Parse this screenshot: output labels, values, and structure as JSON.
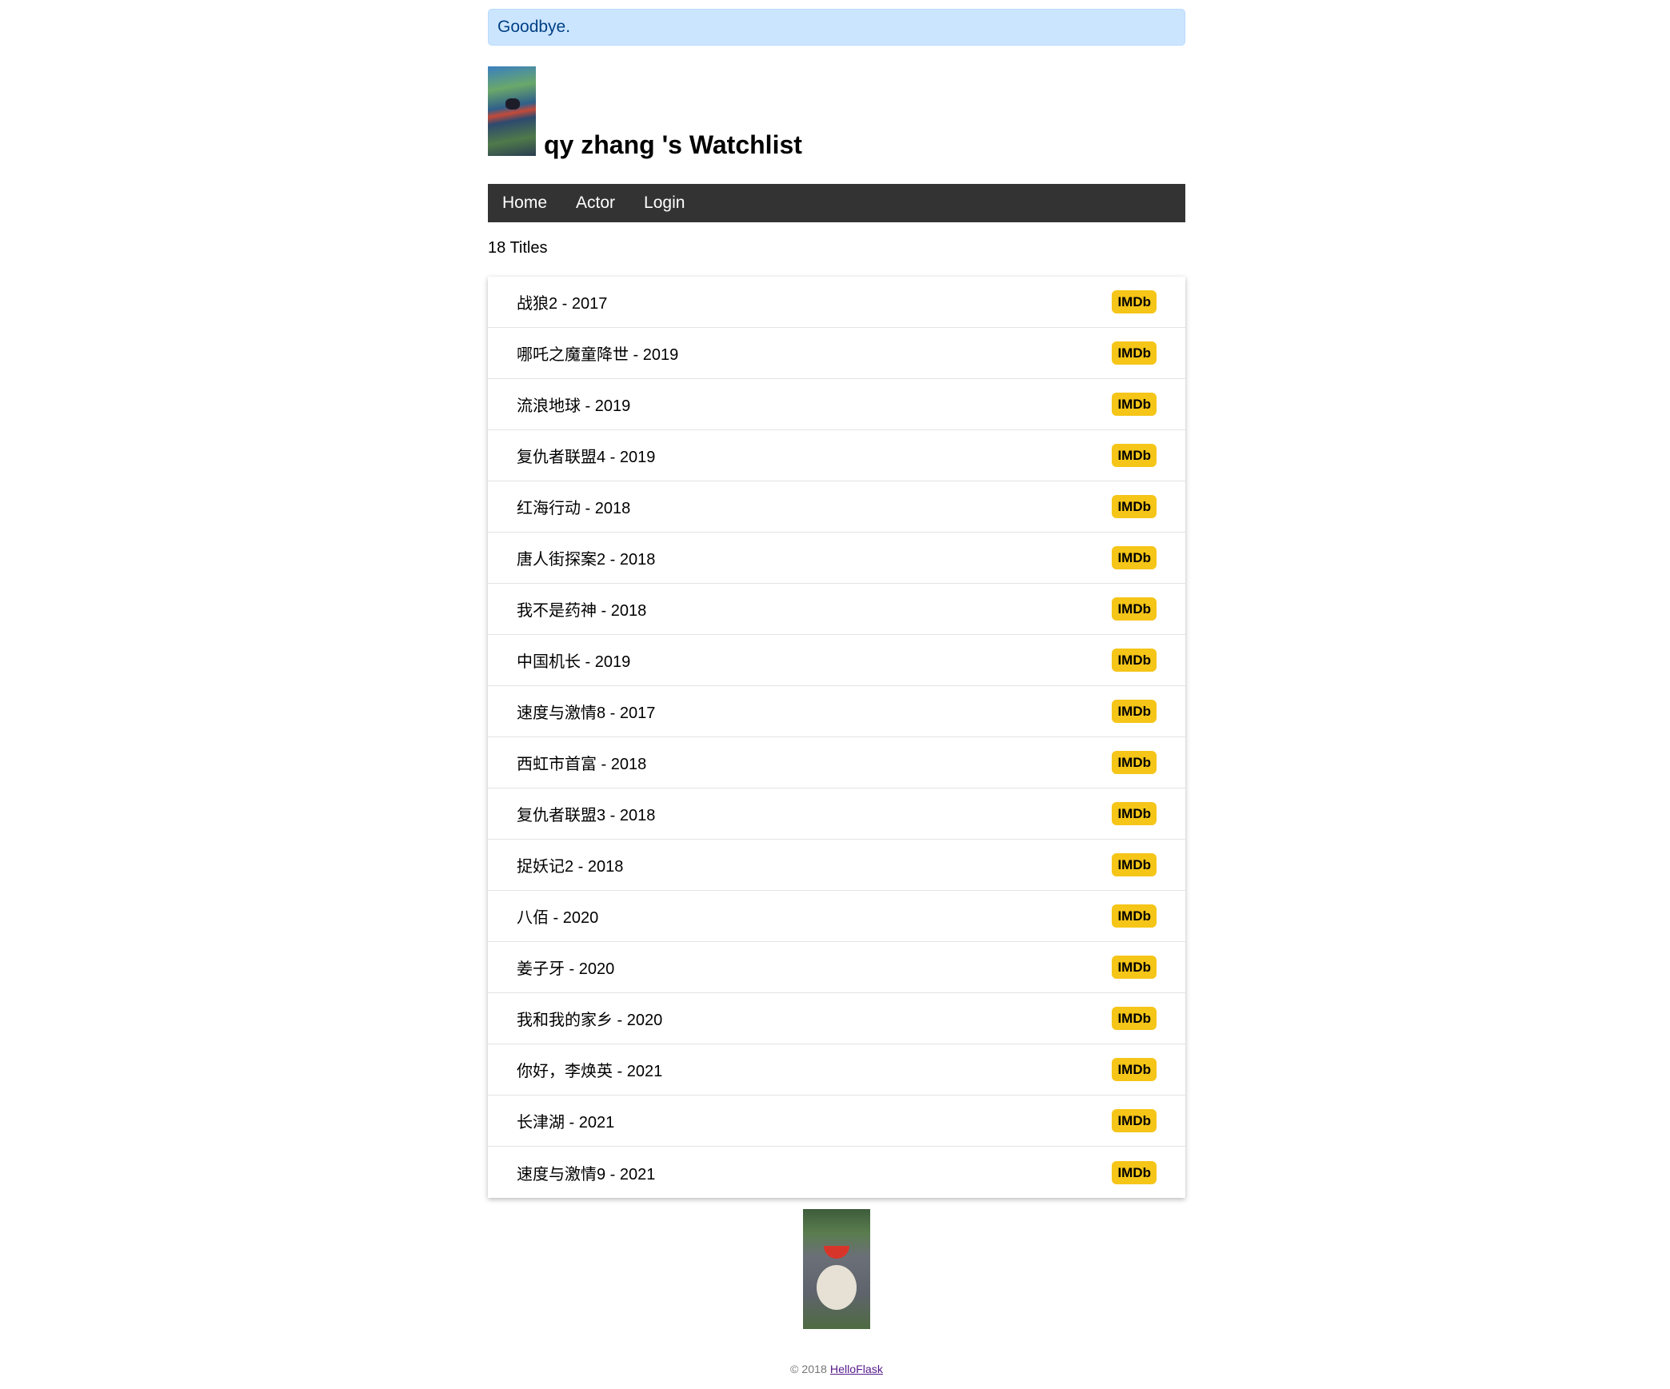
{
  "flash": {
    "message": "Goodbye."
  },
  "header": {
    "title": "qy zhang 's Watchlist"
  },
  "nav": {
    "items": [
      {
        "label": "Home"
      },
      {
        "label": "Actor"
      },
      {
        "label": "Login"
      }
    ]
  },
  "summary": {
    "count_text": "18 Titles"
  },
  "movies": [
    {
      "label": "战狼2 - 2017",
      "link": "IMDb"
    },
    {
      "label": "哪吒之魔童降世 - 2019",
      "link": "IMDb"
    },
    {
      "label": "流浪地球 - 2019",
      "link": "IMDb"
    },
    {
      "label": "复仇者联盟4 - 2019",
      "link": "IMDb"
    },
    {
      "label": "红海行动 - 2018",
      "link": "IMDb"
    },
    {
      "label": "唐人街探案2 - 2018",
      "link": "IMDb"
    },
    {
      "label": "我不是药神 - 2018",
      "link": "IMDb"
    },
    {
      "label": "中国机长 - 2019",
      "link": "IMDb"
    },
    {
      "label": "速度与激情8 - 2017",
      "link": "IMDb"
    },
    {
      "label": "西虹市首富 - 2018",
      "link": "IMDb"
    },
    {
      "label": "复仇者联盟3 - 2018",
      "link": "IMDb"
    },
    {
      "label": "捉妖记2 - 2018",
      "link": "IMDb"
    },
    {
      "label": "八佰 - 2020",
      "link": "IMDb"
    },
    {
      "label": "姜子牙 - 2020",
      "link": "IMDb"
    },
    {
      "label": "我和我的家乡 - 2020",
      "link": "IMDb"
    },
    {
      "label": "你好，李焕英 - 2021",
      "link": "IMDb"
    },
    {
      "label": "长津湖 - 2021",
      "link": "IMDb"
    },
    {
      "label": "速度与激情9 - 2021",
      "link": "IMDb"
    }
  ],
  "footer": {
    "copyright": "© 2018",
    "link_label": "HelloFlask"
  },
  "colors": {
    "nav_bg": "#333333",
    "imdb_badge": "#f5c518",
    "flash_bg": "#cce5ff",
    "flash_text": "#004085"
  }
}
